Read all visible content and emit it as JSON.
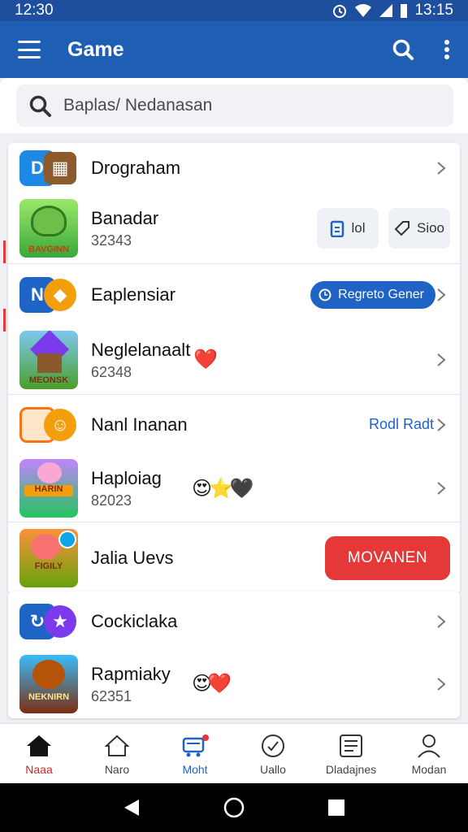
{
  "status_bar": {
    "time_left": "12:30",
    "time_right": "13:15"
  },
  "app_bar": {
    "title": "Game"
  },
  "search": {
    "placeholder": "Baplas/ Nedanasan"
  },
  "sections": [
    {
      "header": {
        "name": "Drograham"
      },
      "item": {
        "name": "Banadar",
        "number": "32343",
        "icon_text": "BAVGINN",
        "action_buttons": [
          {
            "label": "lol",
            "icon": "clipboard-icon"
          },
          {
            "label": "Sioo",
            "icon": "tag-icon"
          }
        ]
      }
    },
    {
      "header": {
        "name": "Eaplensiar",
        "badge_label": "Regreto Gener"
      },
      "item": {
        "name": "Neglelanaalt",
        "number": "62348",
        "icon_text": "MEONSK",
        "reaction": "❤️"
      }
    },
    {
      "header": {
        "name": "Nanl Inanan",
        "link_label": "Rodl Radt"
      },
      "item": {
        "name": "Haploiag",
        "number": "82023",
        "icon_text": "HARIN",
        "reaction": "😍⭐🖤"
      }
    },
    {
      "header": {
        "name": "Jalia Uevs",
        "button_label": "MOVANEN",
        "icon_text": "FIGILY"
      }
    },
    {
      "header": {
        "name": "Cockiclaka"
      },
      "item": {
        "name": "Rapmiaky",
        "number": "62351",
        "icon_text": "NEKNIRN",
        "reaction": "😍❤️"
      }
    }
  ],
  "bottom_nav": [
    {
      "label": "Naaa",
      "icon": "home-filled-icon",
      "state": "active",
      "color": "#c62828"
    },
    {
      "label": "Naro",
      "icon": "home-outline-icon"
    },
    {
      "label": "Moht",
      "icon": "cart-icon",
      "color": "#1f63c6"
    },
    {
      "label": "Uallo",
      "icon": "clock-icon"
    },
    {
      "label": "Dladajnes",
      "icon": "list-icon"
    },
    {
      "label": "Modan",
      "icon": "user-icon"
    }
  ],
  "colors": {
    "app_bar": "#1f5fb3",
    "status_bar": "#1d4f9e",
    "accent_blue": "#1f63c6",
    "accent_red": "#e53838"
  }
}
